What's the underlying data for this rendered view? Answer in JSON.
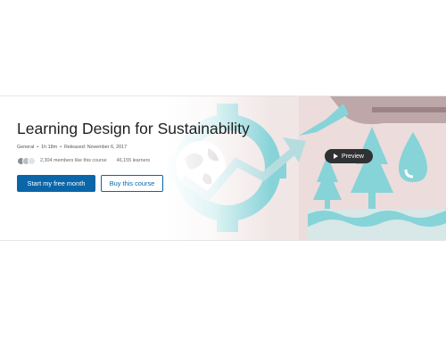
{
  "course": {
    "title": "Learning Design for Sustainability",
    "category": "General",
    "duration": "1h 18m",
    "released": "Released: November 6, 2017",
    "members_text": "2,304 members like this course",
    "learners_text": "46,155 learners"
  },
  "actions": {
    "primary_label": "Start my free month",
    "secondary_label": "Buy this course",
    "preview_label": "Preview"
  },
  "icons": {
    "preview": "play-icon",
    "avatars": "member-avatar-icons"
  },
  "colors": {
    "accent": "#0a66a8",
    "art_teal": "#7fd0d6",
    "art_pink": "#e9dedf",
    "art_mauve": "#c9b7b8"
  }
}
